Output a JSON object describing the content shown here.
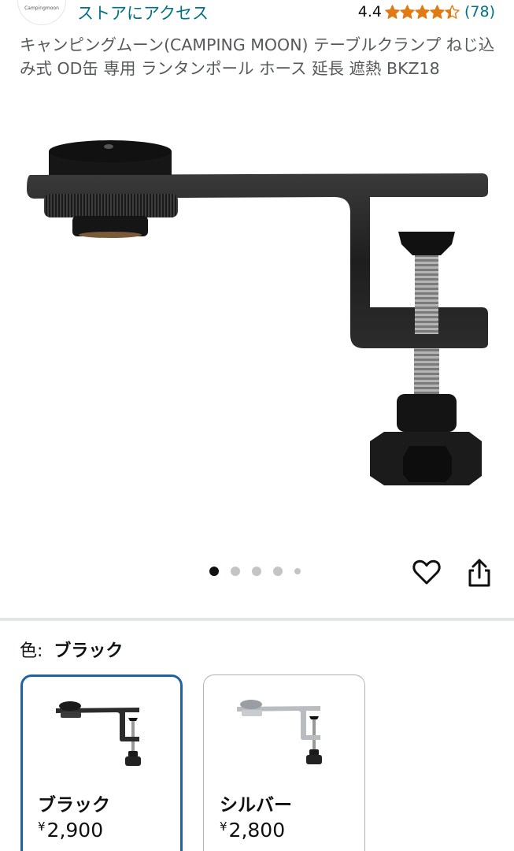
{
  "store": {
    "logo_text": "Campingmoon",
    "link_label": "ストアにアクセス",
    "rating_value": "4.4",
    "rating_stars": 4.4,
    "rating_count": "(78)",
    "star_color": "#e07a13"
  },
  "product": {
    "title": "キャンピングムーン(CAMPING MOON) テーブルクランプ ねじ込み式 OD缶 専用 ランタンポール ホース 延長 遮熱 BKZ18"
  },
  "gallery": {
    "image_count": 5,
    "active_index": 0,
    "icons": [
      "heart-icon",
      "share-icon"
    ]
  },
  "variation": {
    "label": "色:",
    "selected_value": "ブラック",
    "options": [
      {
        "name": "ブラック",
        "currency": "¥",
        "price": "2,900",
        "selected": true,
        "thumb_color": "#2b2b2b"
      },
      {
        "name": "シルバー",
        "currency": "¥",
        "price": "2,800",
        "selected": false,
        "thumb_color": "#b9bcc0"
      }
    ]
  },
  "colors": {
    "link": "#007185",
    "selected_border": "#2162a1",
    "text": "#0f1111",
    "secondary_text": "#565959"
  }
}
